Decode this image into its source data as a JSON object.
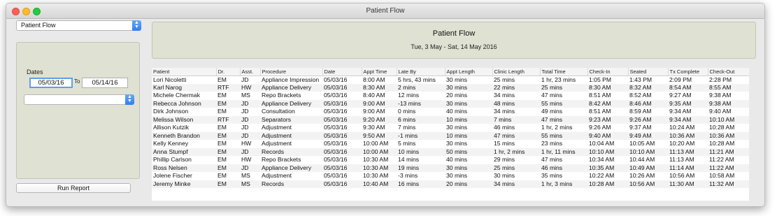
{
  "window": {
    "title": "Patient Flow"
  },
  "sidebar": {
    "report_select": "Patient Flow",
    "dates_label": "Dates",
    "date_from": "05/03/16",
    "to_label": "To",
    "date_to": "05/14/16",
    "secondary_select": "",
    "run_button": "Run Report"
  },
  "header": {
    "title": "Patient Flow",
    "range": "Tue, 3 May - Sat, 14 May 2016"
  },
  "table": {
    "columns": [
      "Patient",
      "Dr.",
      "Asst.",
      "Procedure",
      "Date",
      "Appt Time",
      "Late By",
      "Appt Length",
      "Clinic Length",
      "Total Time",
      "Check-In",
      "Seated",
      "Tx Complete",
      "Check-Out"
    ],
    "rows": [
      [
        "Lori Nicoletti",
        "EM",
        "JD",
        "Appliance Impression",
        "05/03/16",
        "8:00 AM",
        "5 hrs, 43 mins",
        "30 mins",
        "25 mins",
        "1 hr, 23 mins",
        "1:05 PM",
        "1:43 PM",
        "2:09 PM",
        "2:28 PM"
      ],
      [
        "Karl Narog",
        "RTF",
        "HW",
        "Appliance Delivery",
        "05/03/16",
        "8:30 AM",
        "2 mins",
        "30 mins",
        "22 mins",
        "25 mins",
        "8:30 AM",
        "8:32 AM",
        "8:54 AM",
        "8:55 AM"
      ],
      [
        "Michele Chermak",
        "EM",
        "MS",
        "Repo Brackets",
        "05/03/16",
        "8:40 AM",
        "12 mins",
        "20 mins",
        "34 mins",
        "47 mins",
        "8:51 AM",
        "8:52 AM",
        "9:27 AM",
        "9:38 AM"
      ],
      [
        "Rebecca Johnson",
        "EM",
        "JD",
        "Appliance Delivery",
        "05/03/16",
        "9:00 AM",
        "-13 mins",
        "30 mins",
        "48 mins",
        "55 mins",
        "8:42 AM",
        "8:46 AM",
        "9:35 AM",
        "9:38 AM"
      ],
      [
        "Dirk Johnson",
        "EM",
        "JD",
        "Consultation",
        "05/03/16",
        "9:00 AM",
        "0 mins",
        "40 mins",
        "34 mins",
        "49 mins",
        "8:51 AM",
        "8:59 AM",
        "9:34 AM",
        "9:40 AM"
      ],
      [
        "Melissa Wilson",
        "RTF",
        "JD",
        "Separators",
        "05/03/16",
        "9:20 AM",
        "6 mins",
        "10 mins",
        "7 mins",
        "47 mins",
        "9:23 AM",
        "9:26 AM",
        "9:34 AM",
        "10:10 AM"
      ],
      [
        "Allison Kutzik",
        "EM",
        "JD",
        "Adjustment",
        "05/03/16",
        "9:30 AM",
        "7 mins",
        "30 mins",
        "46 mins",
        "1 hr, 2 mins",
        "9:26 AM",
        "9:37 AM",
        "10:24 AM",
        "10:28 AM"
      ],
      [
        "Kenneth Brandon",
        "EM",
        "JD",
        "Adjustment",
        "05/03/16",
        "9:50 AM",
        "-1 mins",
        "10 mins",
        "47 mins",
        "55 mins",
        "9:40 AM",
        "9:49 AM",
        "10:36 AM",
        "10:36 AM"
      ],
      [
        "Kelly Kenney",
        "EM",
        "HW",
        "Adjustment",
        "05/03/16",
        "10:00 AM",
        "5 mins",
        "30 mins",
        "15 mins",
        "23 mins",
        "10:04 AM",
        "10:05 AM",
        "10:20 AM",
        "10:28 AM"
      ],
      [
        "Anna Stumpf",
        "EM",
        "JD",
        "Records",
        "05/03/16",
        "10:00 AM",
        "10 mins",
        "50 mins",
        "1 hr, 2 mins",
        "1 hr, 11 mins",
        "10:10 AM",
        "10:10 AM",
        "11:13 AM",
        "11:21 AM"
      ],
      [
        "Phillip Carlson",
        "EM",
        "HW",
        "Repo Brackets",
        "05/03/16",
        "10:30 AM",
        "14 mins",
        "40 mins",
        "29 mins",
        "47 mins",
        "10:34 AM",
        "10:44 AM",
        "11:13 AM",
        "11:22 AM"
      ],
      [
        "Ross Nelsen",
        "EM",
        "JD",
        "Appliance Delivery",
        "05/03/16",
        "10:30 AM",
        "19 mins",
        "30 mins",
        "25 mins",
        "46 mins",
        "10:35 AM",
        "10:49 AM",
        "11:14 AM",
        "11:22 AM"
      ],
      [
        "Jolene Fischer",
        "EM",
        "MS",
        "Adjustment",
        "05/03/16",
        "10:30 AM",
        "-3 mins",
        "30 mins",
        "30 mins",
        "35 mins",
        "10:22 AM",
        "10:26 AM",
        "10:56 AM",
        "10:58 AM"
      ],
      [
        "Jeremy Minke",
        "EM",
        "MS",
        "Records",
        "05/03/16",
        "10:40 AM",
        "16 mins",
        "20 mins",
        "34 mins",
        "1 hr, 3 mins",
        "10:28 AM",
        "10:56 AM",
        "11:30 AM",
        "11:32 AM"
      ]
    ]
  }
}
